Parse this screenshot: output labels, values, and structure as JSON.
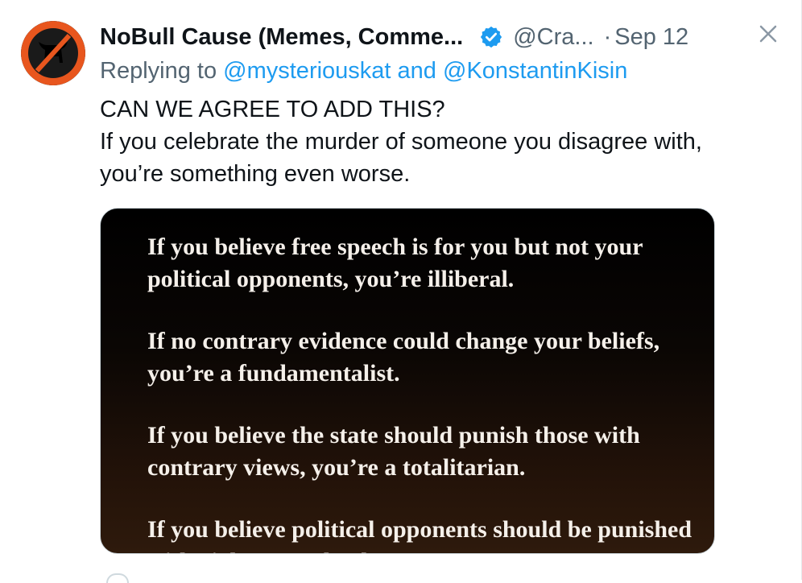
{
  "tweet": {
    "display_name": "NoBull Cause (Memes, Comme...",
    "handle": "@Cra...",
    "separator": "·",
    "date": "Sep 12",
    "reply_prefix": "Replying to",
    "reply_mention_1": "@mysteriouskat",
    "reply_and": "and",
    "reply_mention_2": "@KonstantinKisin",
    "text_line_1": "CAN WE AGREE TO ADD THIS?",
    "text_line_2": "If you celebrate the murder of someone you disagree with, you’re something even worse."
  },
  "media": {
    "paragraphs": [
      "If you believe free speech is for you but not your political opponents, you’re illiberal.",
      "If no contrary evidence could change your beliefs, you’re a fundamentalist.",
      "If you believe the state should punish those with contrary views, you’re a totalitarian.",
      "If you believe political opponents should be punished with violence or death, you’re a"
    ]
  },
  "icons": {
    "avatar": "bull-avatar-icon",
    "verified": "verified-badge-icon",
    "close": "close-icon"
  },
  "colors": {
    "link": "#1d9bf0",
    "secondary_text": "#536471",
    "verified_badge": "#1d9bf0"
  }
}
